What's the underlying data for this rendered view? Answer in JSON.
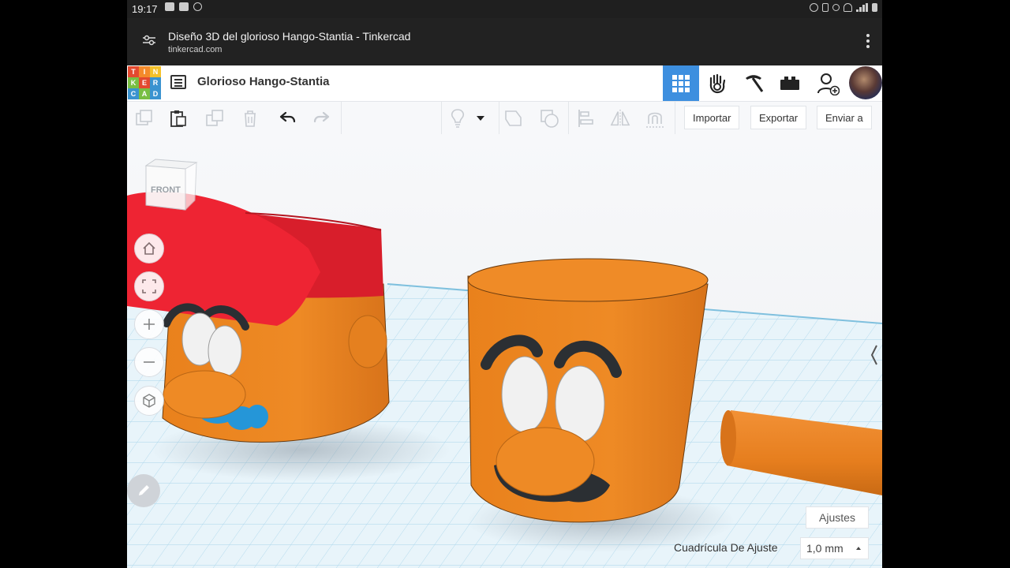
{
  "status_bar": {
    "time": "19:17"
  },
  "browser": {
    "page_title": "Diseño 3D del glorioso Hango-Stantia - Tinkercad",
    "domain": "tinkercad.com"
  },
  "logo": {
    "letters": [
      "T",
      "I",
      "N",
      "K",
      "E",
      "R",
      "C",
      "A",
      "D"
    ],
    "colors": [
      "#e3492f",
      "#f48a2a",
      "#f4c12a",
      "#78bf43",
      "#e3492f",
      "#3a93d0",
      "#3a93d0",
      "#78bf43",
      "#3a93d0"
    ]
  },
  "header": {
    "design_title": "Glorioso Hango-Stantia",
    "active_view_color": "#3d8fdf"
  },
  "toolbar": {
    "import_label": "Importar",
    "export_label": "Exportar",
    "send_label": "Enviar a"
  },
  "viewcube": {
    "face_label": "FRONT"
  },
  "workplane": {
    "settings_label": "Ajustes",
    "snap_label": "Cuadrícula De Ajuste",
    "snap_value": "1,0 mm"
  },
  "colors": {
    "orange": "#e8801f",
    "red": "#d81e2b",
    "blue": "#2596d8",
    "black": "#2b2f33",
    "white": "#f1f1f1"
  },
  "icons": [
    "copy-icon",
    "paste-icon",
    "duplicate-icon",
    "delete-icon",
    "undo-icon",
    "redo-icon",
    "lightbulb-icon",
    "shape-group-icon",
    "hole-icon",
    "align-icon",
    "mirror-icon",
    "magnet-icon",
    "home-icon",
    "fit-view-icon",
    "zoom-in-icon",
    "zoom-out-icon",
    "orthographic-icon",
    "edit-icon"
  ]
}
